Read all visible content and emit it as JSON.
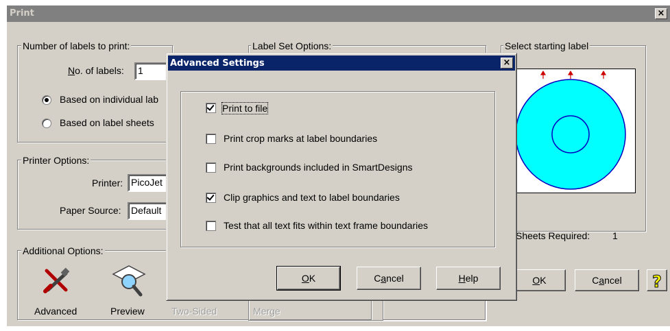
{
  "window": {
    "title": "Print",
    "close": "×"
  },
  "count_group": {
    "label": "Number of labels to print:",
    "no_labels_label": "No. of labels:",
    "no_labels_accel": "N",
    "no_labels_rest": "o. of labels:",
    "no_labels_value": "1",
    "radio_individual": "Based on individual lab",
    "radio_sheets": "Based on label sheets",
    "selected": "individual"
  },
  "printer_group": {
    "label": "Printer Options:",
    "printer_label": "Printer:",
    "printer_value": "PicoJet",
    "paper_label": "Paper Source:",
    "paper_value": "Default"
  },
  "additional_group": {
    "label": "Additional Options:",
    "advanced": "Advanced",
    "preview": "Preview",
    "two_sided": "Two-Sided",
    "merge": "Merge"
  },
  "label_set_group": {
    "label": "Label Set Options:"
  },
  "start_group": {
    "label": "Select starting label",
    "sheets_required_label": "Sheets Required:",
    "sheets_required_value": "1"
  },
  "main_buttons": {
    "ok": "OK",
    "ok_accel": "O",
    "ok_rest": "K",
    "cancel": "Cancel",
    "cancel_pre": "C",
    "cancel_accel": "a",
    "cancel_rest": "ncel",
    "help_icon": "?"
  },
  "dialog": {
    "title": "Advanced Settings",
    "close": "×",
    "options": [
      {
        "label": "Print to file",
        "checked": true
      },
      {
        "label": "Print crop marks at label boundaries",
        "checked": false
      },
      {
        "label": "Print backgrounds included in SmartDesigns",
        "checked": false
      },
      {
        "label": "Clip graphics and text to label boundaries",
        "checked": true
      },
      {
        "label": "Test that all text fits within text frame boundaries",
        "checked": false
      }
    ],
    "ok_accel": "O",
    "ok_rest": "K",
    "cancel_pre": "C",
    "cancel_accel": "a",
    "cancel_rest": "ncel",
    "help_accel": "H",
    "help_rest": "elp"
  },
  "colors": {
    "disc": "#00ffff",
    "disc_stroke": "#0000c0",
    "arrow": "#cc0000",
    "title_active": "#0a246a",
    "title_inactive": "#808080"
  },
  "icons": {
    "advanced": "tools-icon",
    "preview": "magnifier-icon",
    "help": "help-icon"
  }
}
